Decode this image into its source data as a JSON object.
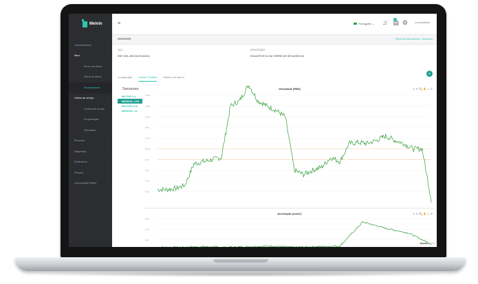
{
  "app": {
    "name": "Melvin"
  },
  "sidebar": {
    "items": [
      {
        "label": "Gerenciamento",
        "kind": "top"
      },
      {
        "label": "Ativo",
        "kind": "top-active"
      },
      {
        "label": "Árvore de ativos",
        "kind": "sub"
      },
      {
        "label": "Painel de ativos",
        "kind": "sub"
      },
      {
        "label": "Monitoramento",
        "kind": "sub-active"
      },
      {
        "label": "Ordem de serviço",
        "kind": "top-active"
      },
      {
        "label": "Carteira de serviço",
        "kind": "sub"
      },
      {
        "label": "Programação",
        "kind": "sub"
      },
      {
        "label": "Solicitação",
        "kind": "sub"
      },
      {
        "label": "Recursos",
        "kind": "top"
      },
      {
        "label": "Segurança",
        "kind": "top"
      },
      {
        "label": "Parâmetros",
        "kind": "top"
      },
      {
        "label": "Pessoal",
        "kind": "top"
      },
      {
        "label": "Universidade Melvin",
        "kind": "top"
      }
    ]
  },
  "topbar": {
    "language": "Português",
    "logo_text": "comunidade"
  },
  "breadcrumb": {
    "title": "Sensores",
    "path": "Painel Monitoramento  >  Sensores"
  },
  "asset": {
    "tag_label": "TAG",
    "tag_value": "RKF-SOL-SEC02-EX40215",
    "desc_label": "DESCRIÇÃO",
    "desc_value": "EXAUSTOR 01 DA TORRE DE SECAGEM 02"
  },
  "tabs": [
    "Configuração",
    "Análise Preditiva",
    "Histórico de Alarme"
  ],
  "active_tab": 1,
  "sensors": {
    "title": "Sensores",
    "items": [
      "MOTOR LA",
      "MANCAL LOA",
      "MOTOR LOA",
      "MANCAL LA"
    ],
    "active_index": 1
  },
  "footer": {
    "brand": "Melvin",
    "suffix": "3.0.0"
  },
  "colors": {
    "accent": "#2ec4b6",
    "series": "#2e9e3a",
    "threshold": "#f3c9a4"
  },
  "chart_data": [
    {
      "type": "line",
      "title": "Velocidade (RMS)",
      "toolbar": "⊖ ⊕ 🔍 ✋ ⌂ ☰",
      "y_ticks": [
        "12.96",
        "10.86",
        "10.06",
        "9.64",
        "12.43",
        "10.18",
        "9.17",
        "7.92",
        "7.75",
        "8.60"
      ],
      "threshold_rows": [
        5,
        6
      ],
      "series": [
        {
          "values": [
            0.12,
            0.12,
            0.13,
            0.16,
            0.36,
            0.38,
            0.4,
            0.42,
            0.9,
            0.95,
            1.1,
            0.95,
            0.9,
            0.86,
            0.8,
            0.3,
            0.26,
            0.3,
            0.33,
            0.42,
            0.38,
            0.55,
            0.56,
            0.55,
            0.58,
            0.62,
            0.58,
            0.55,
            0.5,
            0.5,
            0.02
          ]
        }
      ]
    },
    {
      "type": "line",
      "title": "Aceleração (mm/s²)",
      "toolbar": "⊖ ⊕ 🔍 ✋ ⌂ ☰",
      "y_ticks": [
        "9.69",
        "9.72",
        "9.81"
      ],
      "series": [
        {
          "values": [
            0.1,
            0.1,
            0.12,
            0.1,
            0.12,
            0.14,
            0.1,
            0.12,
            0.14,
            0.9,
            0.7,
            0.55,
            0.2
          ]
        }
      ]
    }
  ]
}
